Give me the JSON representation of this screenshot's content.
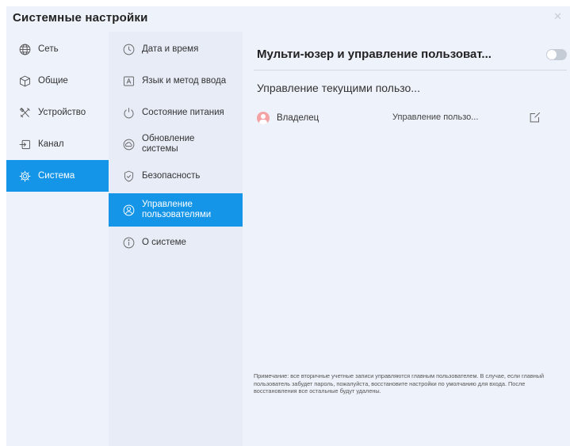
{
  "window": {
    "title": "Системные настройки",
    "close_symbol": "✕"
  },
  "nav": {
    "items": [
      {
        "label": "Сеть",
        "icon": "globe-icon"
      },
      {
        "label": "Общие",
        "icon": "cube-icon"
      },
      {
        "label": "Устройство",
        "icon": "tools-icon"
      },
      {
        "label": "Канал",
        "icon": "input-icon"
      },
      {
        "label": "Система",
        "icon": "gear-icon",
        "active": true
      }
    ]
  },
  "subnav": {
    "items": [
      {
        "label": "Дата и время",
        "icon": "clock-icon"
      },
      {
        "label": "Язык и метод ввода",
        "icon": "language-icon"
      },
      {
        "label": "Состояние питания",
        "icon": "power-icon"
      },
      {
        "label": "Обновление системы",
        "icon": "cloud-upload-icon"
      },
      {
        "label": "Безопасность",
        "icon": "shield-icon"
      },
      {
        "label": "Управление пользователями",
        "icon": "user-circle-icon",
        "active": true
      },
      {
        "label": "О системе",
        "icon": "info-icon"
      }
    ]
  },
  "panel": {
    "title": "Мульти-юзер и управление пользоват...",
    "toggle_on": false,
    "section_title": "Управление текущими пользо...",
    "user": {
      "name": "Владелец",
      "manage_label": "Управление пользо...",
      "avatar_color": "#f3a3a3"
    },
    "note": "Примечание: все вторичные учетные записи управляются главным пользователем. В случае, если главный пользователь забудет пароль, пожалуйста, восстановите настройки по умолчанию для входа. После восстановления все остальные будут удалены."
  },
  "colors": {
    "accent": "#1495e8",
    "background": "#eef2fa",
    "subnav_bg": "#e7ecf7"
  }
}
